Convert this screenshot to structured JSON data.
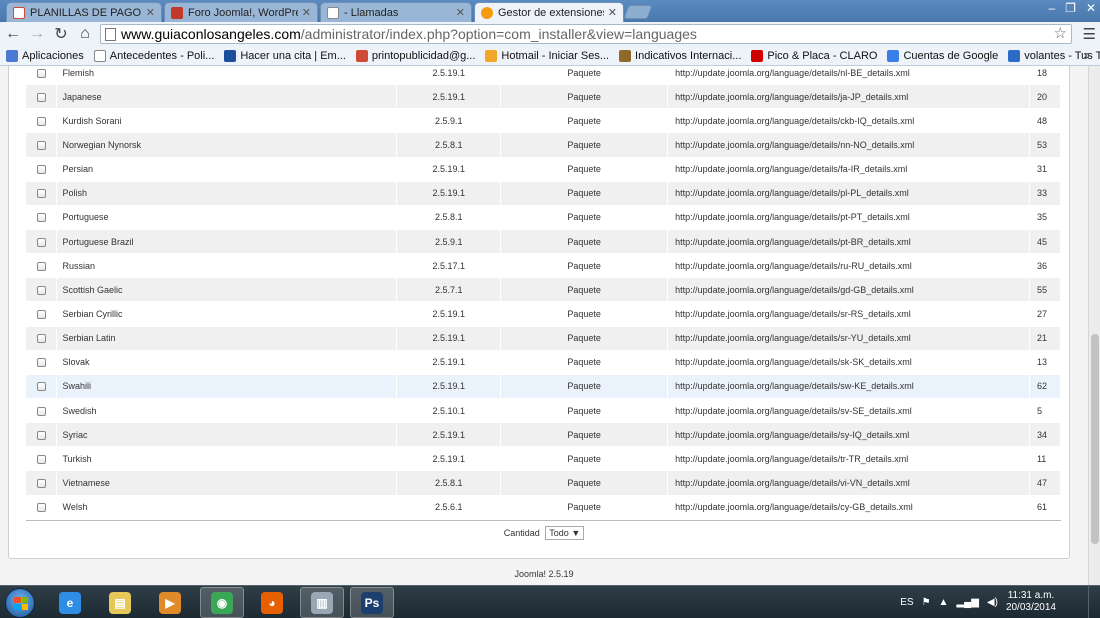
{
  "browser": {
    "tabs": [
      {
        "label": "PLANILLAS DE PAGO SEG",
        "icon": "gmail-icon",
        "color": "#d14836"
      },
      {
        "label": "Foro Joomla!, WordPress",
        "icon": "forum-icon",
        "color": "#c0392b"
      },
      {
        "label": "- Llamadas",
        "icon": "page-icon",
        "color": "#ffffff"
      },
      {
        "label": "Gestor de extensiones - In",
        "icon": "joomla-icon",
        "color": "#f39c12"
      }
    ],
    "url_host": "www.guiaconlosangeles.com",
    "url_path": "/administrator/index.php?option=com_installer&view=languages",
    "window_controls": [
      "‒",
      "❐",
      "✕"
    ]
  },
  "bookmarks": [
    {
      "label": "Aplicaciones",
      "color": "#4a7bd0"
    },
    {
      "label": "Antecedentes - Poli...",
      "color": "#ffffff"
    },
    {
      "label": "Hacer una cita | Em...",
      "color": "#1a4f9c"
    },
    {
      "label": "printopublicidad@g...",
      "color": "#d14836"
    },
    {
      "label": "Hotmail - Iniciar Ses...",
      "color": "#f2a52b"
    },
    {
      "label": "Indicativos Internaci...",
      "color": "#8e6a2a"
    },
    {
      "label": "Pico & Placa - CLARO",
      "color": "#d00000"
    },
    {
      "label": "Cuentas de Google",
      "color": "#3b7de9"
    },
    {
      "label": "volantes - Tus Tarjet...",
      "color": "#2a6bc5"
    }
  ],
  "languages": [
    {
      "name": "Flemish",
      "version": "2.5.19.1",
      "type": "Paquete",
      "url": "http://update.joomla.org/language/details/nl-BE_details.xml",
      "id": "18"
    },
    {
      "name": "Japanese",
      "version": "2.5.19.1",
      "type": "Paquete",
      "url": "http://update.joomla.org/language/details/ja-JP_details.xml",
      "id": "20"
    },
    {
      "name": "Kurdish Sorani",
      "version": "2.5.9.1",
      "type": "Paquete",
      "url": "http://update.joomla.org/language/details/ckb-IQ_details.xml",
      "id": "48"
    },
    {
      "name": "Norwegian Nynorsk",
      "version": "2.5.8.1",
      "type": "Paquete",
      "url": "http://update.joomla.org/language/details/nn-NO_details.xml",
      "id": "53"
    },
    {
      "name": "Persian",
      "version": "2.5.19.1",
      "type": "Paquete",
      "url": "http://update.joomla.org/language/details/fa-IR_details.xml",
      "id": "31"
    },
    {
      "name": "Polish",
      "version": "2.5.19.1",
      "type": "Paquete",
      "url": "http://update.joomla.org/language/details/pl-PL_details.xml",
      "id": "33"
    },
    {
      "name": "Portuguese",
      "version": "2.5.8.1",
      "type": "Paquete",
      "url": "http://update.joomla.org/language/details/pt-PT_details.xml",
      "id": "35"
    },
    {
      "name": "Portuguese Brazil",
      "version": "2.5.9.1",
      "type": "Paquete",
      "url": "http://update.joomla.org/language/details/pt-BR_details.xml",
      "id": "45"
    },
    {
      "name": "Russian",
      "version": "2.5.17.1",
      "type": "Paquete",
      "url": "http://update.joomla.org/language/details/ru-RU_details.xml",
      "id": "36"
    },
    {
      "name": "Scottish Gaelic",
      "version": "2.5.7.1",
      "type": "Paquete",
      "url": "http://update.joomla.org/language/details/gd-GB_details.xml",
      "id": "55"
    },
    {
      "name": "Serbian Cyrillic",
      "version": "2.5.19.1",
      "type": "Paquete",
      "url": "http://update.joomla.org/language/details/sr-RS_details.xml",
      "id": "27"
    },
    {
      "name": "Serbian Latin",
      "version": "2.5.19.1",
      "type": "Paquete",
      "url": "http://update.joomla.org/language/details/sr-YU_details.xml",
      "id": "21"
    },
    {
      "name": "Slovak",
      "version": "2.5.19.1",
      "type": "Paquete",
      "url": "http://update.joomla.org/language/details/sk-SK_details.xml",
      "id": "13"
    },
    {
      "name": "Swahili",
      "version": "2.5.19.1",
      "type": "Paquete",
      "url": "http://update.joomla.org/language/details/sw-KE_details.xml",
      "id": "62",
      "highlighted": true
    },
    {
      "name": "Swedish",
      "version": "2.5.10.1",
      "type": "Paquete",
      "url": "http://update.joomla.org/language/details/sv-SE_details.xml",
      "id": "5"
    },
    {
      "name": "Syriac",
      "version": "2.5.19.1",
      "type": "Paquete",
      "url": "http://update.joomla.org/language/details/sy-IQ_details.xml",
      "id": "34"
    },
    {
      "name": "Turkish",
      "version": "2.5.19.1",
      "type": "Paquete",
      "url": "http://update.joomla.org/language/details/tr-TR_details.xml",
      "id": "11"
    },
    {
      "name": "Vietnamese",
      "version": "2.5.8.1",
      "type": "Paquete",
      "url": "http://update.joomla.org/language/details/vi-VN_details.xml",
      "id": "47"
    },
    {
      "name": "Welsh",
      "version": "2.5.6.1",
      "type": "Paquete",
      "url": "http://update.joomla.org/language/details/cy-GB_details.xml",
      "id": "61"
    }
  ],
  "pagination": {
    "label": "Cantidad",
    "selected": "Todo",
    "arrow": "▼"
  },
  "footer": {
    "text": "Joomla! 2.5.19"
  },
  "taskbar": {
    "apps": [
      {
        "name": "internet-explorer-icon",
        "color": "#2f8de4",
        "glyph": "e"
      },
      {
        "name": "file-explorer-icon",
        "color": "#e6c75a",
        "glyph": "▤"
      },
      {
        "name": "media-player-icon",
        "color": "#e08a2a",
        "glyph": "▶"
      },
      {
        "name": "chrome-icon",
        "color": "#3aa757",
        "glyph": "◉",
        "active": true
      },
      {
        "name": "firefox-icon",
        "color": "#e66000",
        "glyph": "◕"
      },
      {
        "name": "remote-desktop-icon",
        "color": "#9aa7b4",
        "glyph": "▥",
        "active": true
      },
      {
        "name": "photoshop-icon",
        "color": "#1d3f6e",
        "glyph": "Ps",
        "active": true
      }
    ],
    "language": "ES",
    "time": "11:31 a.m.",
    "date": "20/03/2014"
  }
}
